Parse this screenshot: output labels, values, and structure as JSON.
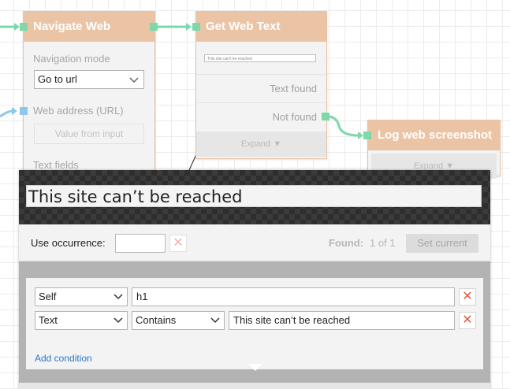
{
  "nodes": {
    "navigate": {
      "title": "Navigate Web",
      "mode_label": "Navigation mode",
      "mode_value": "Go to url",
      "address_label": "Web address (URL)",
      "address_value": "Value from input",
      "text_fields_label": "Text fields"
    },
    "get_text": {
      "title": "Get Web Text",
      "mini_text": "This site can't be reached",
      "output_found": "Text found",
      "output_not_found": "Not found",
      "expand": "Expand"
    },
    "log": {
      "title": "Log web screenshot",
      "expand": "Expand"
    }
  },
  "panel": {
    "preview_text": "This site can’t be reached",
    "use_occurrence_label": "Use occurrence:",
    "occurrence_value": "",
    "found_label": "Found:",
    "found_value": "1 of 1",
    "set_current_label": "Set current",
    "conditions": [
      {
        "target": "Self",
        "operator": "",
        "value": "h1"
      },
      {
        "target": "Text",
        "operator": "Contains",
        "value": "This site can’t be reached"
      }
    ],
    "add_condition_label": "Add condition",
    "remove_symbol": "✕",
    "chevron": "▼"
  },
  "colors": {
    "node_header": "#ebc4a6",
    "port_green": "#7dd8aa",
    "port_blue": "#8fc6ee",
    "link": "#2a7ac7",
    "remove": "#e25b3c"
  }
}
